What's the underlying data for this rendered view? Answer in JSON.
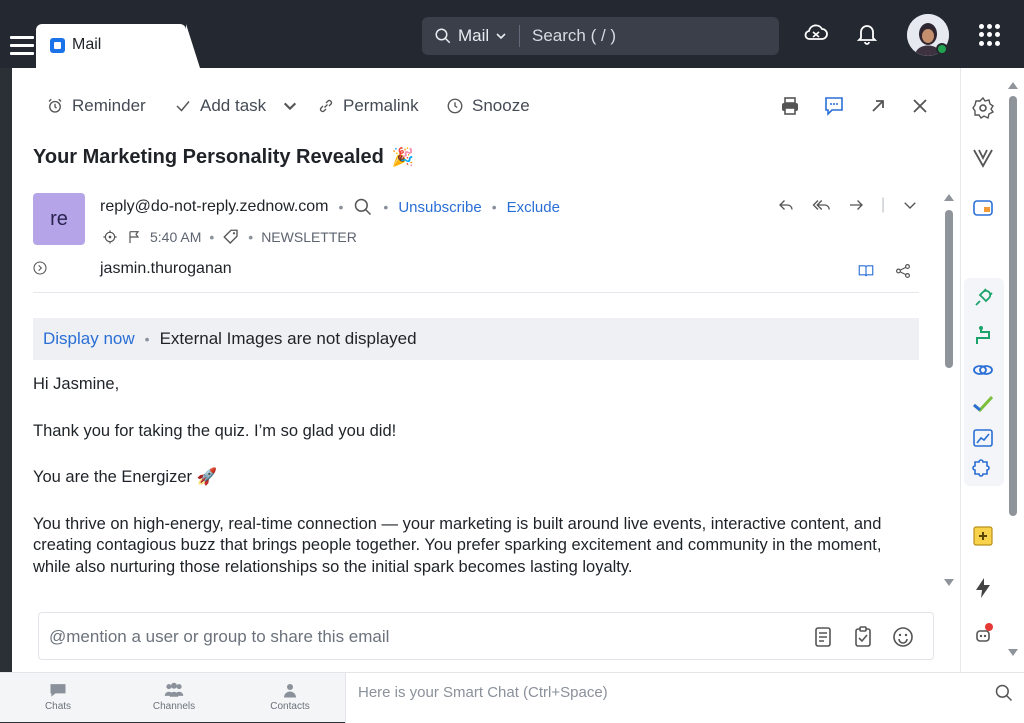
{
  "header": {
    "app_tab": "Mail",
    "search_scope": "Mail",
    "search_placeholder": "Search ( / )"
  },
  "toolbar": {
    "reminder": "Reminder",
    "add_task": "Add task",
    "permalink": "Permalink",
    "snooze": "Snooze"
  },
  "email": {
    "subject": "Your Marketing Personality Revealed",
    "subject_emoji": "🎉",
    "avatar_initials": "re",
    "from": "reply@do-not-reply.zednow.com",
    "unsubscribe": "Unsubscribe",
    "exclude": "Exclude",
    "time": "5:40 AM",
    "label": "NEWSLETTER",
    "to": "jasmin.thuroganan"
  },
  "banner": {
    "display_now": "Display now",
    "message": "External Images are not displayed"
  },
  "body": {
    "greeting": "Hi Jasmine,",
    "p1": "Thank you for taking the quiz. I’m so glad you did!",
    "p2": "You are the Energizer 🚀",
    "p3": "You thrive on high-energy, real-time connection — your marketing is built around live events, interactive content, and creating contagious buzz that brings people together. You prefer sparking excitement and community in the moment, while also nurturing those relationships so the initial spark becomes lasting loyalty."
  },
  "comment": {
    "placeholder": "@mention a user or group to share this email"
  },
  "bottom": {
    "chats": "Chats",
    "channels": "Channels",
    "contacts": "Contacts",
    "smartchat_placeholder": "Here is your Smart Chat (Ctrl+Space)"
  },
  "colors": {
    "topbar": "#242831",
    "link": "#2a6fd6",
    "avatar_bg": "#b5a4e8",
    "status_online": "#22a350"
  }
}
